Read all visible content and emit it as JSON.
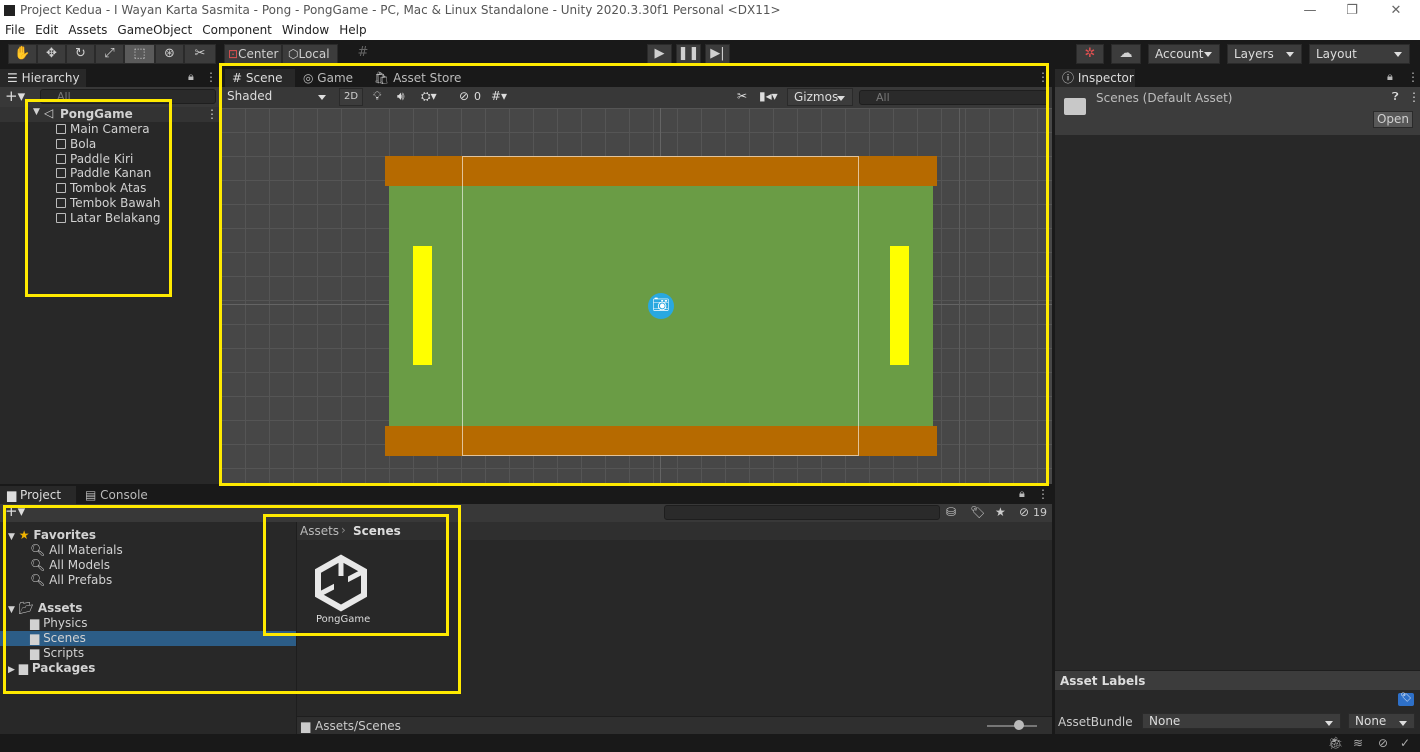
{
  "window": {
    "title": "Project Kedua - I Wayan Karta Sasmita - Pong - PongGame - PC, Mac & Linux Standalone - Unity 2020.3.30f1 Personal <DX11>",
    "min": "—",
    "max": "❐",
    "close": "✕"
  },
  "menu": [
    "File",
    "Edit",
    "Assets",
    "GameObject",
    "Component",
    "Window",
    "Help"
  ],
  "toolbar": {
    "center": "Center",
    "local": "Local",
    "account": "Account",
    "layers": "Layers",
    "layout": "Layout"
  },
  "hierarchy": {
    "tab": "Hierarchy",
    "search": "All",
    "scene": "PongGame",
    "items": [
      "Main Camera",
      "Bola",
      "Paddle Kiri",
      "Paddle Kanan",
      "Tombok Atas",
      "Tembok Bawah",
      "Latar Belakang"
    ]
  },
  "scene": {
    "tabs": [
      "Scene",
      "Game",
      "Asset Store"
    ],
    "shading": "Shaded",
    "mode2d": "2D",
    "hidden_count": "0",
    "gizmos": "Gizmos",
    "search": "All"
  },
  "game_colors": {
    "field": "#6a9c45",
    "wall": "#b66a00",
    "paddle": "#ffff00",
    "background": "#474747"
  },
  "inspector": {
    "tab": "Inspector",
    "title": "Scenes (Default Asset)",
    "open": "Open",
    "asset_labels": "Asset Labels",
    "asset_bundle_label": "AssetBundle",
    "asset_bundle_value": "None",
    "variant_value": "None"
  },
  "project": {
    "tabs": [
      "Project",
      "Console"
    ],
    "favorites": "Favorites",
    "fav_items": [
      "All Materials",
      "All Models",
      "All Prefabs"
    ],
    "assets": "Assets",
    "asset_folders": [
      "Physics",
      "Scenes",
      "Scripts"
    ],
    "packages": "Packages",
    "breadcrumb_root": "Assets",
    "breadcrumb_current": "Scenes",
    "file": "PongGame",
    "path": "Assets/Scenes",
    "hidden_count": "19"
  }
}
